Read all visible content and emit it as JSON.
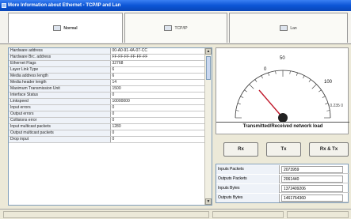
{
  "window": {
    "title": "More Information about Ethernet - TCP/IP and Lan"
  },
  "tabs": [
    {
      "label": "Normal",
      "icon": "network-card-icon"
    },
    {
      "label": "TCP/IP",
      "icon": "tcpip-icon"
    },
    {
      "label": "Lan",
      "icon": "lan-icon"
    }
  ],
  "properties": [
    {
      "name": "Hardware address",
      "value": "00-A0-91-4A-07-CC"
    },
    {
      "name": "Hardware Brc. address",
      "value": "FF-FF-FF-FF-FF-FF"
    },
    {
      "name": "Ethernet Flags",
      "value": "32768"
    },
    {
      "name": "Layer Link Type",
      "value": "6"
    },
    {
      "name": "Media address length",
      "value": "6"
    },
    {
      "name": "Media header length",
      "value": "14"
    },
    {
      "name": "Maximum Transmission Unit",
      "value": "1500"
    },
    {
      "name": "Interface Status",
      "value": "0"
    },
    {
      "name": "Linkspeed",
      "value": "10000000"
    },
    {
      "name": "Input errors",
      "value": "0"
    },
    {
      "name": "Output errors",
      "value": "0"
    },
    {
      "name": "Collisions error",
      "value": "0"
    },
    {
      "name": "Input multicast packets",
      "value": "1280"
    },
    {
      "name": "Output multicast packets",
      "value": "0"
    },
    {
      "name": "Drop input",
      "value": "0"
    }
  ],
  "gauge": {
    "ticks": [
      "0",
      "50",
      "100"
    ],
    "value_text": "0.235 0",
    "title": "Transmitted/Received network load"
  },
  "buttons": {
    "rx": "Rx",
    "tx": "Tx",
    "rxtx": "Rx & Tx"
  },
  "stats": [
    {
      "label": "Inputs Packets",
      "value": "2073959"
    },
    {
      "label": "Outputs Packets",
      "value": "2061440"
    },
    {
      "label": "Inputs Bytes",
      "value": "1372409206"
    },
    {
      "label": "Outputs Bytes",
      "value": "1461764360"
    }
  ],
  "colors": {
    "titlebar": "#0b55d6",
    "needle": "#c0182a"
  }
}
